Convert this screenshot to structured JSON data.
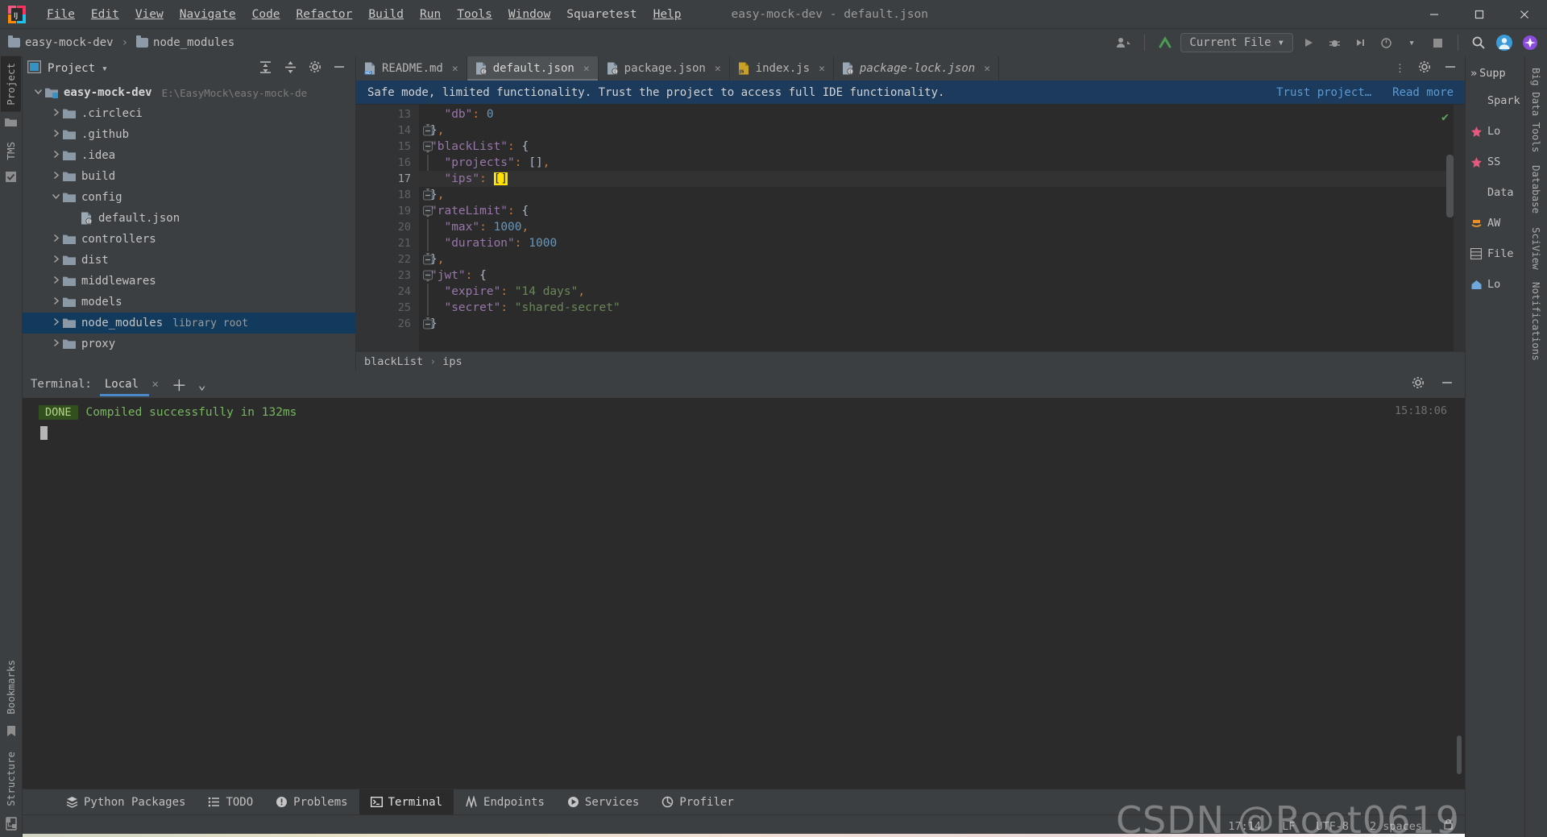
{
  "window": {
    "title": "easy-mock-dev - default.json",
    "minimize": "–",
    "maximize": "▢",
    "close": "✕"
  },
  "menubar": {
    "items": [
      "File",
      "Edit",
      "View",
      "Navigate",
      "Code",
      "Refactor",
      "Build",
      "Run",
      "Tools",
      "Window",
      "Squaretest",
      "Help"
    ]
  },
  "navbar": {
    "breadcrumbs": [
      "easy-mock-dev",
      "node_modules"
    ],
    "run_config": "Current File",
    "icons": [
      "account-icon",
      "vcs-update-icon",
      "run-icon",
      "debug-icon",
      "coverage-icon",
      "profile-icon",
      "more-run-icon",
      "stop-icon",
      "search-icon",
      "user-avatar-icon",
      "ai-assistant-icon"
    ]
  },
  "left_strip": {
    "tabs": [
      "Project",
      "TMS"
    ],
    "icons": [
      "folder-icon",
      "commit-icon",
      "bookmarks-icon",
      "structure-icon"
    ],
    "bottom_tabs": [
      "Bookmarks",
      "Structure"
    ]
  },
  "project_panel": {
    "title": "Project",
    "tree": [
      {
        "indent": 0,
        "arrow": "v",
        "icon": "module-folder-icon",
        "label": "easy-mock-dev",
        "bold": true,
        "dim": "E:\\EasyMock\\easy-mock-de",
        "selected": false
      },
      {
        "indent": 1,
        "arrow": ">",
        "icon": "folder-icon",
        "label": ".circleci",
        "bold": false,
        "dim": "",
        "selected": false
      },
      {
        "indent": 1,
        "arrow": ">",
        "icon": "folder-icon",
        "label": ".github",
        "bold": false,
        "dim": "",
        "selected": false
      },
      {
        "indent": 1,
        "arrow": ">",
        "icon": "folder-icon",
        "label": ".idea",
        "bold": false,
        "dim": "",
        "selected": false
      },
      {
        "indent": 1,
        "arrow": ">",
        "icon": "folder-icon",
        "label": "build",
        "bold": false,
        "dim": "",
        "selected": false
      },
      {
        "indent": 1,
        "arrow": "v",
        "icon": "folder-icon",
        "label": "config",
        "bold": false,
        "dim": "",
        "selected": false
      },
      {
        "indent": 2,
        "arrow": "",
        "icon": "json-file-icon",
        "label": "default.json",
        "bold": false,
        "dim": "",
        "selected": false
      },
      {
        "indent": 1,
        "arrow": ">",
        "icon": "folder-icon",
        "label": "controllers",
        "bold": false,
        "dim": "",
        "selected": false
      },
      {
        "indent": 1,
        "arrow": ">",
        "icon": "folder-icon",
        "label": "dist",
        "bold": false,
        "dim": "",
        "selected": false
      },
      {
        "indent": 1,
        "arrow": ">",
        "icon": "folder-icon",
        "label": "middlewares",
        "bold": false,
        "dim": "",
        "selected": false
      },
      {
        "indent": 1,
        "arrow": ">",
        "icon": "folder-icon",
        "label": "models",
        "bold": false,
        "dim": "",
        "selected": false
      },
      {
        "indent": 1,
        "arrow": ">",
        "icon": "folder-icon",
        "label": "node_modules",
        "bold": false,
        "dim": "library root",
        "selected": true
      },
      {
        "indent": 1,
        "arrow": ">",
        "icon": "folder-icon",
        "label": "proxy",
        "bold": false,
        "dim": "",
        "selected": false
      }
    ]
  },
  "editor": {
    "tabs": [
      {
        "label": "README.md",
        "icon": "markdown-file-icon",
        "active": false,
        "italic": false
      },
      {
        "label": "default.json",
        "icon": "json-file-icon",
        "active": true,
        "italic": false
      },
      {
        "label": "package.json",
        "icon": "json-file-icon",
        "active": false,
        "italic": false
      },
      {
        "label": "index.js",
        "icon": "js-file-icon",
        "active": false,
        "italic": false
      },
      {
        "label": "package-lock.json",
        "icon": "json-file-icon",
        "active": false,
        "italic": true
      }
    ],
    "notification": {
      "message": "Safe mode, limited functionality. Trust the project to access full IDE functionality.",
      "action_primary": "Trust project…",
      "action_secondary": "Read more"
    },
    "lines": [
      {
        "num": "13",
        "fold": "",
        "current": false,
        "tokens": [
          {
            "t": "  ",
            "c": "k-br"
          },
          {
            "t": "\"db\"",
            "c": "k-prop"
          },
          {
            "t": ":",
            "c": "k-punc"
          },
          {
            "t": " ",
            "c": "k-br"
          },
          {
            "t": "0",
            "c": "k-num"
          }
        ]
      },
      {
        "num": "14",
        "fold": "end",
        "current": false,
        "tokens": [
          {
            "t": "}",
            "c": "k-br"
          },
          {
            "t": ",",
            "c": "k-punc"
          }
        ]
      },
      {
        "num": "15",
        "fold": "start",
        "current": false,
        "tokens": [
          {
            "t": "\"blackList\"",
            "c": "k-prop"
          },
          {
            "t": ":",
            "c": "k-punc"
          },
          {
            "t": " ",
            "c": "k-br"
          },
          {
            "t": "{",
            "c": "k-br"
          }
        ]
      },
      {
        "num": "16",
        "fold": "",
        "current": false,
        "tokens": [
          {
            "t": "  ",
            "c": "k-br"
          },
          {
            "t": "\"projects\"",
            "c": "k-prop"
          },
          {
            "t": ":",
            "c": "k-punc"
          },
          {
            "t": " ",
            "c": "k-br"
          },
          {
            "t": "[]",
            "c": "k-br"
          },
          {
            "t": ",",
            "c": "k-punc"
          }
        ]
      },
      {
        "num": "17",
        "fold": "",
        "current": true,
        "tokens": [
          {
            "t": "  ",
            "c": "k-br"
          },
          {
            "t": "\"ips\"",
            "c": "k-prop"
          },
          {
            "t": ":",
            "c": "k-punc"
          },
          {
            "t": " ",
            "c": "k-br"
          },
          {
            "t": "[]",
            "c": "sel-br"
          }
        ]
      },
      {
        "num": "18",
        "fold": "end",
        "current": false,
        "tokens": [
          {
            "t": "}",
            "c": "k-br"
          },
          {
            "t": ",",
            "c": "k-punc"
          }
        ]
      },
      {
        "num": "19",
        "fold": "start",
        "current": false,
        "tokens": [
          {
            "t": "\"rateLimit\"",
            "c": "k-prop"
          },
          {
            "t": ":",
            "c": "k-punc"
          },
          {
            "t": " ",
            "c": "k-br"
          },
          {
            "t": "{",
            "c": "k-br"
          }
        ]
      },
      {
        "num": "20",
        "fold": "",
        "current": false,
        "tokens": [
          {
            "t": "  ",
            "c": "k-br"
          },
          {
            "t": "\"max\"",
            "c": "k-prop"
          },
          {
            "t": ":",
            "c": "k-punc"
          },
          {
            "t": " ",
            "c": "k-br"
          },
          {
            "t": "1000",
            "c": "k-num"
          },
          {
            "t": ",",
            "c": "k-punc"
          }
        ]
      },
      {
        "num": "21",
        "fold": "",
        "current": false,
        "tokens": [
          {
            "t": "  ",
            "c": "k-br"
          },
          {
            "t": "\"duration\"",
            "c": "k-prop"
          },
          {
            "t": ":",
            "c": "k-punc"
          },
          {
            "t": " ",
            "c": "k-br"
          },
          {
            "t": "1000",
            "c": "k-num"
          }
        ]
      },
      {
        "num": "22",
        "fold": "end",
        "current": false,
        "tokens": [
          {
            "t": "}",
            "c": "k-br"
          },
          {
            "t": ",",
            "c": "k-punc"
          }
        ]
      },
      {
        "num": "23",
        "fold": "start",
        "current": false,
        "tokens": [
          {
            "t": "\"jwt\"",
            "c": "k-prop"
          },
          {
            "t": ":",
            "c": "k-punc"
          },
          {
            "t": " ",
            "c": "k-br"
          },
          {
            "t": "{",
            "c": "k-br"
          }
        ]
      },
      {
        "num": "24",
        "fold": "",
        "current": false,
        "tokens": [
          {
            "t": "  ",
            "c": "k-br"
          },
          {
            "t": "\"expire\"",
            "c": "k-prop"
          },
          {
            "t": ":",
            "c": "k-punc"
          },
          {
            "t": " ",
            "c": "k-br"
          },
          {
            "t": "\"14 days\"",
            "c": "k-str"
          },
          {
            "t": ",",
            "c": "k-punc"
          }
        ]
      },
      {
        "num": "25",
        "fold": "",
        "current": false,
        "tokens": [
          {
            "t": "  ",
            "c": "k-br"
          },
          {
            "t": "\"secret\"",
            "c": "k-prop"
          },
          {
            "t": ":",
            "c": "k-punc"
          },
          {
            "t": " ",
            "c": "k-br"
          },
          {
            "t": "\"shared-secret\"",
            "c": "k-str"
          }
        ]
      },
      {
        "num": "26",
        "fold": "end",
        "current": false,
        "tokens": [
          {
            "t": "}",
            "c": "k-br"
          }
        ]
      }
    ],
    "breadcrumbs": [
      "blackList",
      "ips"
    ],
    "inspection_status": "✔"
  },
  "terminal": {
    "label": "Terminal:",
    "tab": "Local",
    "add": "＋",
    "chevron": "⌄",
    "output_badge": "DONE",
    "output_text": "Compiled successfully in 132ms",
    "time": "15:18:06"
  },
  "right_panel": {
    "rows": [
      {
        "icon": "bigdata-icon",
        "label": "Spark"
      },
      {
        "icon": "star-icon",
        "label": "Lo"
      },
      {
        "icon": "star-icon",
        "label": "SS"
      },
      {
        "icon": "db-icon",
        "label": "Data"
      },
      {
        "icon": "aws-icon",
        "label": "AW"
      },
      {
        "icon": "grid-icon",
        "label": "File"
      },
      {
        "icon": "home-icon",
        "label": "Lo"
      }
    ],
    "suppress_label": "Supp",
    "vtabs": [
      "Big Data Tools",
      "Database",
      "SciView",
      "Notifications"
    ]
  },
  "bottom_tools": [
    {
      "label": "Python Packages",
      "icon": "python-packages-icon",
      "active": false
    },
    {
      "label": "TODO",
      "icon": "todo-icon",
      "active": false
    },
    {
      "label": "Problems",
      "icon": "problems-icon",
      "active": false
    },
    {
      "label": "Terminal",
      "icon": "terminal-icon",
      "active": true
    },
    {
      "label": "Endpoints",
      "icon": "endpoints-icon",
      "active": false
    },
    {
      "label": "Services",
      "icon": "services-icon",
      "active": false
    },
    {
      "label": "Profiler",
      "icon": "profiler-icon",
      "active": false
    }
  ],
  "statusbar": {
    "position": "17:14",
    "line_sep": "LF",
    "encoding": "UTF-8",
    "indent": "2 spaces",
    "lock": "lock-icon",
    "watermark": "CSDN @Root0619"
  },
  "colors": {
    "accent_blue": "#4a88c7",
    "selection_blue": "#113a5c",
    "notif_blue": "#1b3a5c",
    "panel_bg": "#3c3f41",
    "editor_bg": "#2b2b2b",
    "gutter_bg": "#313335",
    "green": "#76b75f",
    "string_green": "#6a8759",
    "prop_purple": "#9876aa",
    "num_blue": "#6897bb",
    "punct_orange": "#cc7832",
    "highlight_yellow": "#ffe200"
  }
}
